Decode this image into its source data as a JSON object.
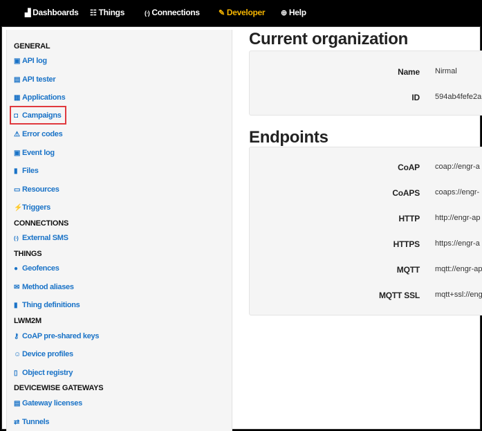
{
  "topnav": {
    "items": [
      {
        "label": "Dashboards",
        "icon": "bar-chart-icon",
        "glyph": "▟"
      },
      {
        "label": "Things",
        "icon": "things-icon",
        "glyph": "☷"
      },
      {
        "label": "Connections",
        "icon": "antenna-icon",
        "glyph": "⁽ᐧ⁾"
      },
      {
        "label": "Developer",
        "icon": "wrench-icon",
        "glyph": "✎"
      },
      {
        "label": "Help",
        "icon": "help-icon",
        "glyph": "⊕"
      }
    ],
    "active_color": "#f4b400"
  },
  "sidebar": {
    "general_heading": "GENERAL",
    "connections_heading": "CONNECTIONS",
    "things_heading": "THINGS",
    "lwm2m_heading": "LWM2M",
    "gateways_heading": "DEVICEWISE GATEWAYS",
    "links": {
      "api_log": "API log",
      "api_tester": "API tester",
      "applications": "Applications",
      "campaigns": "Campaigns",
      "error_codes": "Error codes",
      "event_log": "Event log",
      "files": "Files",
      "resources": "Resources",
      "triggers": "Triggers",
      "external_sms": "External SMS",
      "geofences": "Geofences",
      "method_aliases": "Method aliases",
      "thing_definitions": "Thing definitions",
      "coap_psk": "CoAP pre-shared keys",
      "device_profiles": "Device profiles",
      "object_registry": "Object registry",
      "gateway_licenses": "Gateway licenses",
      "tunnels": "Tunnels"
    },
    "link_color": "#1a73c7",
    "highlight_color": "#e0393e"
  },
  "main": {
    "org_title": "Current organization",
    "org": [
      {
        "label": "Name",
        "value": "Nirmal"
      },
      {
        "label": "ID",
        "value": "594ab4fefe2a"
      }
    ],
    "endpoints_title": "Endpoints",
    "endpoints": [
      {
        "label": "CoAP",
        "value": "coap://engr-a"
      },
      {
        "label": "CoAPS",
        "value": "coaps://engr-"
      },
      {
        "label": "HTTP",
        "value": "http://engr-ap"
      },
      {
        "label": "HTTPS",
        "value": "https://engr-a"
      },
      {
        "label": "MQTT",
        "value": "mqtt://engr-ap"
      },
      {
        "label": "MQTT SSL",
        "value": "mqtt+ssl://eng"
      }
    ]
  }
}
